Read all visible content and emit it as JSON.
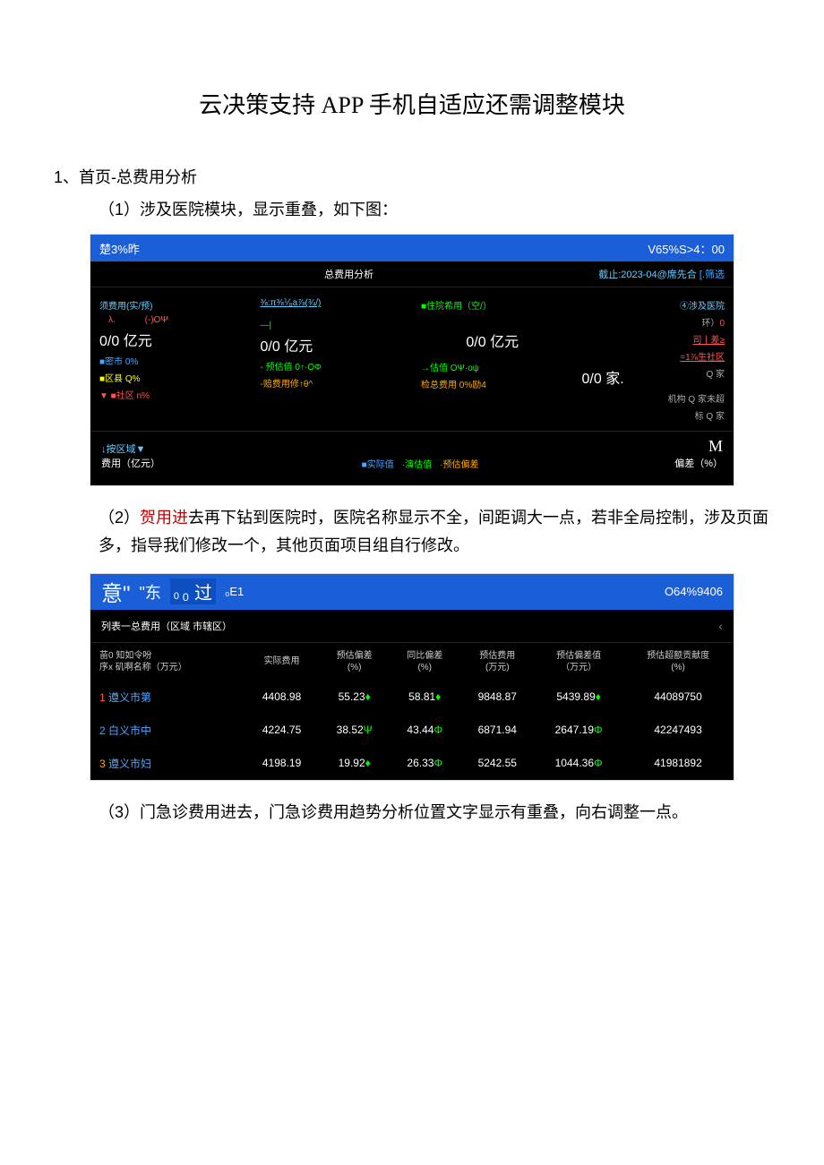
{
  "doc": {
    "title": "云决策支持 APP 手机自适应还需调整模块",
    "section1": "1、首页-总费用分析",
    "sub1": "（1）涉及医院模块，显示重叠，如下图：",
    "p2a": "（2）",
    "p2b": "贺用进",
    "p2c": "去再下钻到医院时，医院名称显示不全，间距调大一点，若非全局控制，涉及页面多，指导我们修改一个，其他页面项目组自行修改。",
    "p3": "（3）门急诊费用进去，门急诊费用趋势分析位置文字显示有重叠，向右调整一点。"
  },
  "ss1": {
    "topLeft": "楚3%昨",
    "topRight": "V65%S>4：00",
    "barTitle": "总费用分析",
    "barDate": "截止:2023-04",
    "barLoc": "@席先合",
    "barFilter": "[.筛选",
    "col1": {
      "title": "须费用(实/预)",
      "sub": "(-)OΨ",
      "val": "0/0 亿元",
      "r1": "■密市 0%",
      "r2": "■区县 Q%",
      "r3": "▼ ■社区 n%"
    },
    "col2": {
      "title": "⅜:π⅜⅟₈a⅞(¾/)",
      "val": "0/0 亿元",
      "r1": "- 预估值 0↑·OΦ",
      "r2": "-赔费用修↑θ^"
    },
    "col3": {
      "title": "■住院希用（空/）",
      "val": "0/0 亿元",
      "r1": "→估值 OΨ·оψ",
      "r2": "检总费用 0%励4"
    },
    "col4": {
      "title": "④涉及医院",
      "r0": "环）0",
      "r1": "司丨差≥",
      "r2": "=1⅞生社区",
      "r3a": "0/0 家.",
      "r3b": "Q 家",
      "r4": "机构 Q 家未超",
      "r5": "标 Q 家"
    },
    "botLeft1": "↓按区域▼",
    "botLeft2": "费用（亿元）",
    "legend": {
      "a": "■实际值",
      "b": "·演估值",
      "c": "·预估偏差"
    },
    "botRightM": "M",
    "botRight": "偏差（%）"
  },
  "ss2": {
    "topL1": "意\"",
    "topL2": "\"东",
    "topL3": "₀ 过",
    "topL4": "₀E1",
    "topR": "O64%9406",
    "crumb": "列表一总费用（区域 市辖区）",
    "headers": {
      "h1": "苗0 知如令吩\n序x 矶啊名称（万元）",
      "h2": "实际费用",
      "h3": "预估偏差\n(%)",
      "h4": "同比偏差\n(%)",
      "h5": "预估费用\n(万元)",
      "h6": "预估偏差值\n（万元）",
      "h7": "预估超额贡献度\n(%)"
    },
    "rows": [
      {
        "name": "遵义市第",
        "v1": "4408.98",
        "v2": "55.23",
        "v2s": "♦",
        "v3": "58.81",
        "v3s": "♦",
        "v4": "9848.87",
        "v5": "5439.89",
        "v5s": "♦",
        "v6": "44089750"
      },
      {
        "name": "白义市中",
        "v1": "4224.75",
        "v2": "38.52",
        "v2s": "Ψ",
        "v3": "43.44",
        "v3s": "Φ",
        "v4": "6871.94",
        "v5": "2647.19",
        "v5s": "Φ",
        "v6": "42247493"
      },
      {
        "name": "遵义市妇",
        "v1": "4198.19",
        "v2": "19.92",
        "v2s": "♦",
        "v3": "26.33",
        "v3s": "Φ",
        "v4": "5242.55",
        "v5": "1044.36",
        "v5s": "Φ",
        "v6": "41981892"
      }
    ]
  }
}
